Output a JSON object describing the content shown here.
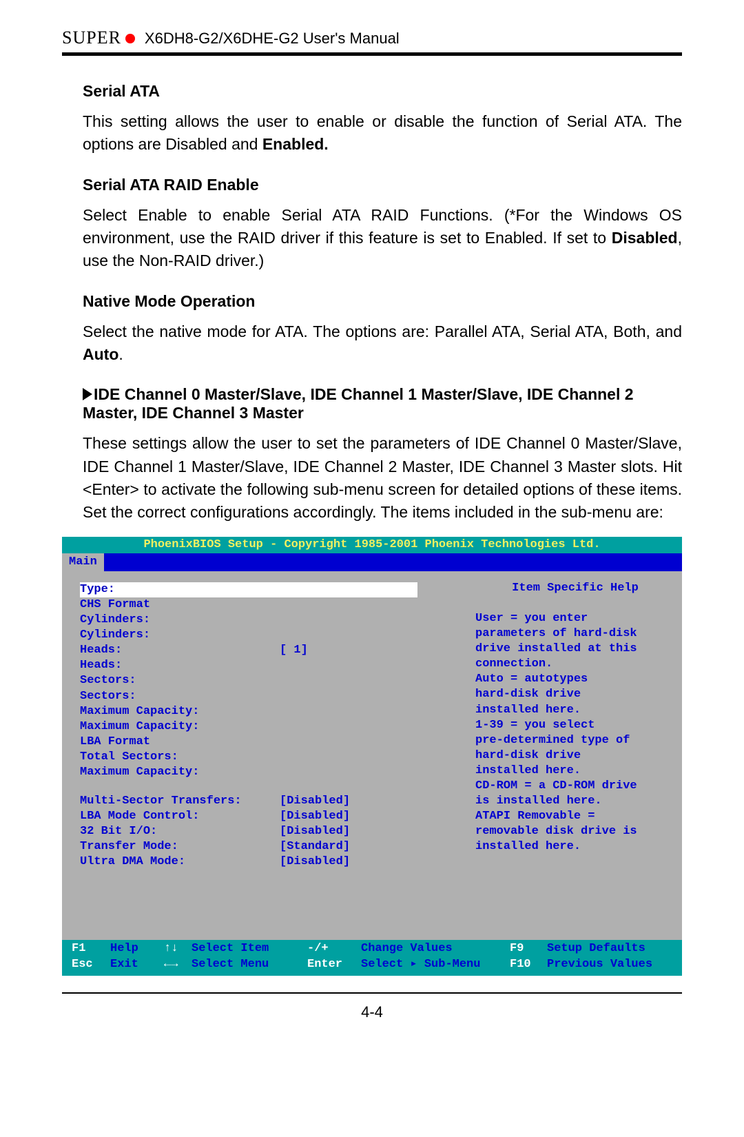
{
  "header": {
    "brand": "SUPER",
    "manual_title": "X6DH8-G2/X6DHE-G2 User's Manual"
  },
  "sections": {
    "serial_ata": {
      "head": "Serial ATA",
      "body_pre": "This setting allows the user to enable or disable the function of  Serial ATA. The options are Disabled and  ",
      "body_bold": "Enabled."
    },
    "sata_raid": {
      "head": "Serial ATA RAID Enable",
      "body_pre": "Select Enable to enable Serial ATA RAID Functions. (*For the Windows OS environment, use the RAID driver if this feature is set to Enabled. If set to ",
      "body_bold": "Disabled",
      "body_post": ", use the Non-RAID driver.)"
    },
    "native_mode": {
      "head": "Native Mode Operation",
      "body_pre": "Select the native mode for ATA. The options are: Parallel ATA, Serial ATA, Both, and ",
      "body_bold": "Auto",
      "body_post": "."
    },
    "ide": {
      "head": "IDE Channel 0 Master/Slave, IDE Channel 1 Master/Slave, IDE Channel 2 Master, IDE Channel 3 Master",
      "body": "These settings allow the user to set the parameters of  IDE Channel 0 Master/Slave, IDE Channel 1 Master/Slave, IDE Channel 2 Master, IDE Channel 3 Master slots.  Hit <Enter> to activate  the following sub-menu screen for detailed options of these items. Set the correct configurations accordingly.  The items included in the sub-menu are:"
    }
  },
  "bios": {
    "title": "PhoenixBIOS Setup - Copyright 1985-2001 Phoenix Technologies Ltd.",
    "tab": "Main",
    "left_rows": [
      {
        "label": "Type:",
        "value": "",
        "hl": true
      },
      {
        "label": "CHS Format",
        "value": ""
      },
      {
        "label": "Cylinders:",
        "value": ""
      },
      {
        "label": "Cylinders:",
        "value": ""
      },
      {
        "label": "Heads:",
        "value": "[  1]"
      },
      {
        "label": "Heads:",
        "value": ""
      },
      {
        "label": "Sectors:",
        "value": ""
      },
      {
        "label": "Sectors:",
        "value": ""
      },
      {
        "label": "Maximum Capacity:",
        "value": ""
      },
      {
        "label": "Maximum Capacity:",
        "value": ""
      },
      {
        "label": "LBA Format",
        "value": ""
      },
      {
        "label": "Total Sectors:",
        "value": ""
      },
      {
        "label": "Maximum Capacity:",
        "value": ""
      }
    ],
    "left_rows2": [
      {
        "label": "Multi-Sector Transfers:",
        "value": "[Disabled]"
      },
      {
        "label": "LBA Mode Control:",
        "value": "[Disabled]"
      },
      {
        "label": "32 Bit I/O:",
        "value": "[Disabled]"
      },
      {
        "label": "Transfer Mode:",
        "value": "[Standard]"
      },
      {
        "label": "Ultra DMA Mode:",
        "value": "[Disabled]"
      }
    ],
    "help_head": "Item Specific Help",
    "help_lines": [
      "User = you enter",
      "parameters of hard-disk",
      "drive installed at this",
      "connection.",
      "Auto = autotypes",
      "hard-disk drive",
      "installed here.",
      "1-39 = you select",
      "pre-determined  type of",
      "hard-disk drive",
      "installed here.",
      "CD-ROM = a CD-ROM drive",
      "is installed here.",
      "ATAPI Removable =",
      "removable disk drive is",
      "installed here."
    ],
    "footer": {
      "r1": {
        "k1": "F1",
        "l1": "Help",
        "k2": "↑↓",
        "l2": "Select Item",
        "k3": "-/+",
        "l3": "Change Values",
        "k4": "F9",
        "l4": "Setup Defaults"
      },
      "r2": {
        "k1": "Esc",
        "l1": "Exit",
        "k2": "←→",
        "l2": "Select Menu",
        "k3": "Enter",
        "l3": "Select ▸ Sub-Menu",
        "k4": "F10",
        "l4": "Previous Values"
      }
    }
  },
  "page_num": "4-4"
}
